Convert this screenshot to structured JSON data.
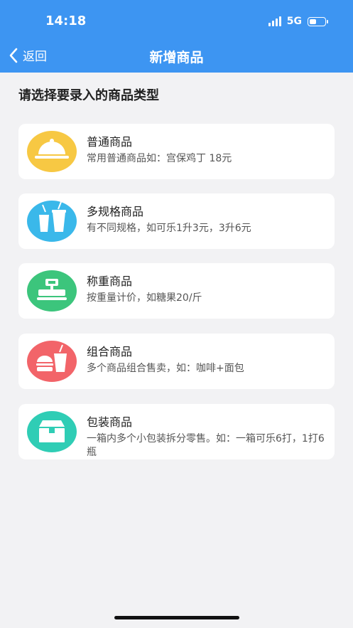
{
  "status": {
    "time": "14:18",
    "network": "5G"
  },
  "nav": {
    "back_label": "返回",
    "title": "新增商品"
  },
  "section_title": "请选择要录入的商品类型",
  "items": [
    {
      "name": "普通商品",
      "desc": "常用普通商品如：宫保鸡丁 18元",
      "icon": "cloche-icon",
      "color": "#f7c843"
    },
    {
      "name": "多规格商品",
      "desc": "有不同规格，如可乐1升3元，3升6元",
      "icon": "drinks-icon",
      "color": "#3ab8ea"
    },
    {
      "name": "称重商品",
      "desc": "按重量计价，如糖果20/斤",
      "icon": "scale-icon",
      "color": "#3cc57c"
    },
    {
      "name": "组合商品",
      "desc": "多个商品组合售卖，如：咖啡+面包",
      "icon": "combo-meal-icon",
      "color": "#f26469"
    },
    {
      "name": "包装商品",
      "desc": "一箱内多个小包装拆分零售。如：一箱可乐6打，1打6瓶",
      "icon": "box-icon",
      "color": "#2fcdb5"
    }
  ]
}
